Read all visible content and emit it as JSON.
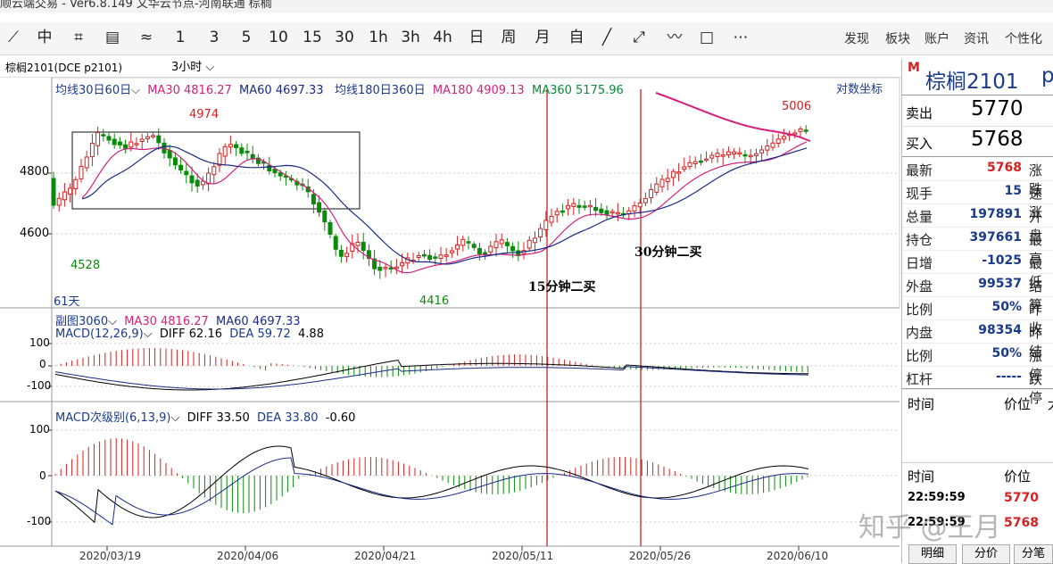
{
  "titlebar": {
    "text": "顺云端交易 - Ver6.8.149   文华云节点-河南联通   棕榈"
  },
  "toolbar": {
    "periods": [
      "1",
      "3",
      "5",
      "10",
      "15",
      "30",
      "1h",
      "3h",
      "4h",
      "日",
      "周",
      "月",
      "自"
    ],
    "menus": [
      "发现",
      "板块",
      "账户",
      "资讯",
      "个性化"
    ]
  },
  "subbar": {
    "contract": "棕榈2101(DCE p2101)",
    "period": "3小时"
  },
  "main_legend": {
    "ma_group": "均线30日60日",
    "ma30": "MA30 4816.27",
    "ma60": "MA60 4697.33",
    "ma_group2": "均线180日360日",
    "ma180": "MA180 4909.13",
    "ma360": "MA360 5175.96",
    "log_axis": "对数坐标",
    "days": "61天"
  },
  "sub1_legend": {
    "title": "副图3060",
    "ma30": "MA30 4816.27",
    "ma60": "MA60 4697.33",
    "macd": "MACD(12,26,9)",
    "diff": "DIFF 62.16",
    "dea": "DEA 59.72",
    "macd_val": "4.88"
  },
  "sub2_legend": {
    "macd": "MACD次级别(6,13,9)",
    "diff": "DIFF 33.50",
    "dea": "DEA 33.80",
    "macd_val": "-0.60"
  },
  "annotations": {
    "buy15": "15分钟二买",
    "buy30": "30分钟二买",
    "p4974": "4974",
    "p4528": "4528",
    "p4416": "4416",
    "p5006": "5006"
  },
  "axes": {
    "main_ticks": [
      "4800",
      "4600"
    ],
    "sub1_ticks": [
      "100",
      "0",
      "-100"
    ],
    "sub2_ticks": [
      "100",
      "0",
      "-100"
    ],
    "dates": [
      "2020/03/19",
      "2020/04/06",
      "2020/04/21",
      "2020/05/11",
      "2020/05/26",
      "2020/06/10"
    ]
  },
  "quote": {
    "logo": "M",
    "name": "棕榈2101",
    "name_tail": "p",
    "sell_label": "卖出",
    "sell_price": "5770",
    "buy_label": "买入",
    "buy_price": "5768",
    "rows": [
      {
        "label": "最新",
        "value": "5768",
        "extra": "涨跌",
        "red": true
      },
      {
        "label": "现手",
        "value": "15",
        "extra": "速涨"
      },
      {
        "label": "总量",
        "value": "197891",
        "extra": "开盘"
      },
      {
        "label": "持仓",
        "value": "397661",
        "extra": "最高"
      },
      {
        "label": "日增",
        "value": "-1025",
        "extra": "最低"
      },
      {
        "label": "外盘",
        "value": "99537",
        "extra": "结算"
      },
      {
        "label": "比例",
        "value": "50%",
        "extra": "昨收"
      },
      {
        "label": "内盘",
        "value": "98354",
        "extra": "昨结"
      },
      {
        "label": "比例",
        "value": "50%",
        "extra": "涨停"
      },
      {
        "label": "杠杆",
        "value": "-----",
        "extra": "跌停"
      }
    ],
    "time_header": "时间",
    "price_header": "价位",
    "amount_header": "大",
    "time_header2": "时间",
    "price_header2": "价位",
    "ticks": [
      {
        "time": "22:59:59",
        "price": "5770"
      },
      {
        "time": "22:59:59",
        "price": "5768"
      }
    ],
    "tabs": [
      "明细",
      "分价",
      "分笔"
    ]
  },
  "watermark": "知乎 @王月",
  "colors": {
    "up": "#d42020",
    "down": "#0a8a0a",
    "ma_pink": "#d4207a",
    "ma_blue": "#1a2a8a",
    "vline": "#c01010"
  }
}
